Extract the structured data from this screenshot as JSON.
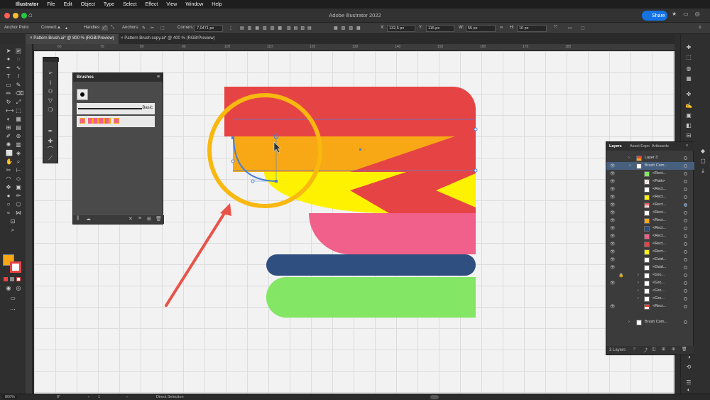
{
  "menubar": {
    "apple": "",
    "app": "Illustrator",
    "items": [
      "File",
      "Edit",
      "Object",
      "Type",
      "Select",
      "Effect",
      "View",
      "Window",
      "Help"
    ]
  },
  "titlebar": {
    "title": "Adobe Illustrator 2022",
    "share": "Share"
  },
  "control": {
    "mode": "Anchor Point",
    "convert": "Convert:",
    "handles": "Handles:",
    "anchors": "Anchors:",
    "corners_label": "Corners:",
    "corners": "7,0471 px",
    "x_label": "X:",
    "x": "132,5 px",
    "y_label": "Y:",
    "y": "115 px",
    "w_label": "W:",
    "w": "55 px",
    "h_label": "H:",
    "h": "10 px"
  },
  "tabs": [
    {
      "label": "Pattern Brush.ai* @ 800 % (RGB/Preview)"
    },
    {
      "label": "Pattern Brush copy.ai* @ 400 % (RGB/Preview)"
    }
  ],
  "ruler": {
    "labels": [
      "60",
      "70",
      "80",
      "90",
      "100",
      "110",
      "120",
      "130",
      "140",
      "150",
      "160",
      "170",
      "180"
    ]
  },
  "brushes": {
    "title": "Brushes",
    "basic": "Basic"
  },
  "layers": {
    "tabs": [
      "Layers",
      "Asset Expo",
      "Artboards"
    ],
    "rows": [
      "Layer 3",
      "Brush Com...",
      "<Rect...",
      "<Path>",
      "<Rect...",
      "<Rect...",
      "<Rect...",
      "<Rect...",
      "<Rect...",
      "<Rect...",
      "<Rect...",
      "<Rect...",
      "<Rect...",
      "<Guid...",
      "<Guid...",
      "<Gro...",
      "<Gro...",
      "<Gro...",
      "<Gro...",
      "<Rect...",
      "Brush Com..."
    ],
    "count": "3 Layers"
  },
  "status": {
    "zoom": "800%",
    "rotation": "0°",
    "artboard": "1",
    "tool": "Direct Selection"
  },
  "colors": {
    "red": "#e64444",
    "orange": "#f7a814",
    "yellow": "#fff200",
    "pink": "#f0608a",
    "navy": "#2e4f7f",
    "green": "#84e665",
    "highlight": "#f8b810",
    "arrow": "#e8534a",
    "selection": "#4a7fd8",
    "share": "#1473e6"
  }
}
